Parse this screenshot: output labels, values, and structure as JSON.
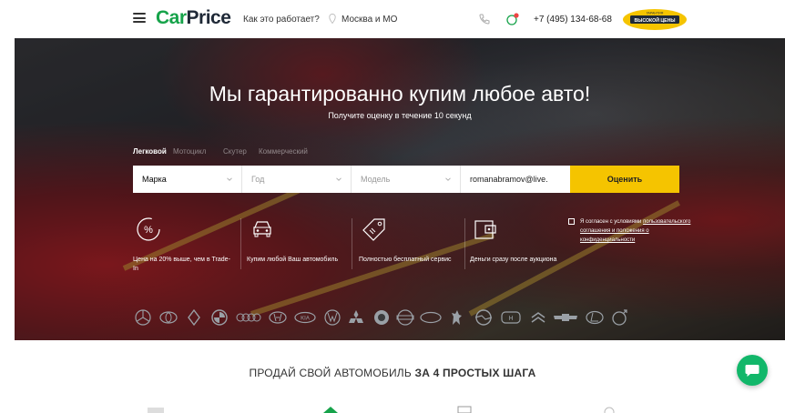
{
  "header": {
    "logo_car": "Car",
    "logo_price": "Price",
    "how_it_works": "Как это работает?",
    "city": "Москва и МО",
    "phone": "+7 (495) 134-68-68",
    "badge_top": "ГАРАНТИЯ",
    "badge_main": "ВЫСОКОЙ ЦЕНЫ"
  },
  "hero": {
    "title": "Мы гарантированно купим любое авто!",
    "subtitle": "Получите оценку в течение 10 секунд",
    "tabs": [
      "Легковой",
      "Мотоцикл",
      "Скутер",
      "Коммерческий"
    ],
    "form": {
      "brand": "Марка",
      "year": "Год",
      "model": "Модель",
      "email": "romanabramov@live.",
      "submit": "Оценить"
    },
    "features": [
      {
        "icon": "percent-icon",
        "text": "Цена на 20% выше, чем в Trade-In"
      },
      {
        "icon": "car-front-icon",
        "text": "Купим любой Ваш автомобиль"
      },
      {
        "icon": "tag-icon",
        "text": "Полностью бесплатный сервис"
      },
      {
        "icon": "wallet-icon",
        "text": "Деньги сразу после аукциона"
      }
    ],
    "consent": {
      "prefix": "Я согласен с условиями",
      "link": "пользовательского соглашения и положения о конфиденциальности"
    }
  },
  "steps": {
    "title_plain": "ПРОДАЙ СВОЙ АВТОМОБИЛЬ",
    "title_bold": "ЗА 4 ПРОСТЫХ ШАГА"
  },
  "colors": {
    "brand_green": "#16a34a",
    "cta_yellow": "#f5c400",
    "chat_green": "#12b76a"
  }
}
